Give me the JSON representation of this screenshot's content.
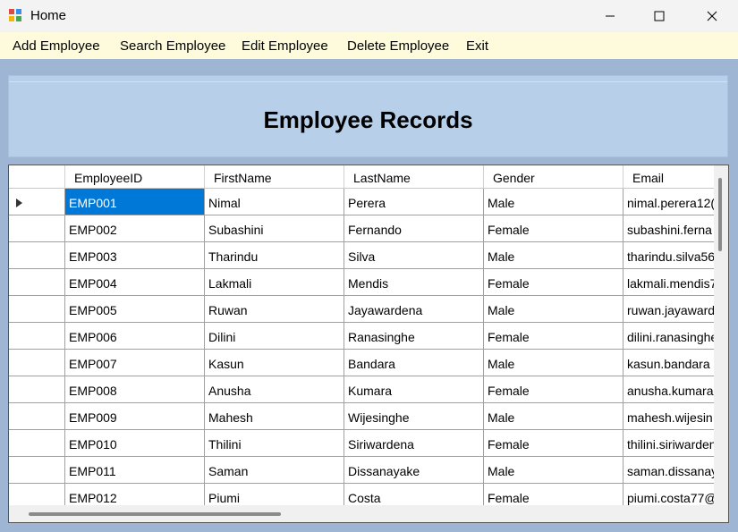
{
  "window": {
    "title": "Home"
  },
  "menu": [
    {
      "label": "Add Employee"
    },
    {
      "label": "Search Employee"
    },
    {
      "label": "Edit Employee"
    },
    {
      "label": "Delete Employee"
    },
    {
      "label": "Exit"
    }
  ],
  "header": {
    "title": "Employee Records"
  },
  "grid": {
    "columns": [
      "EmployeeID",
      "FirstName",
      "LastName",
      "Gender",
      "Email"
    ],
    "selected_row": 0,
    "rows": [
      [
        "EMP001",
        "Nimal",
        "Perera",
        "Male",
        "nimal.perera12("
      ],
      [
        "EMP002",
        "Subashini",
        "Fernando",
        "Female",
        "subashini.ferna"
      ],
      [
        "EMP003",
        "Tharindu",
        "Silva",
        "Male",
        "tharindu.silva56"
      ],
      [
        "EMP004",
        "Lakmali",
        "Mendis",
        "Female",
        "lakmali.mendis7"
      ],
      [
        "EMP005",
        "Ruwan",
        "Jayawardena",
        "Male",
        "ruwan.jayaward"
      ],
      [
        "EMP006",
        "Dilini",
        "Ranasinghe",
        "Female",
        "dilini.ranasinghe"
      ],
      [
        "EMP007",
        "Kasun",
        "Bandara",
        "Male",
        "kasun.bandara"
      ],
      [
        "EMP008",
        "Anusha",
        "Kumara",
        "Female",
        "anusha.kumara"
      ],
      [
        "EMP009",
        "Mahesh",
        "Wijesinghe",
        "Male",
        "mahesh.wijesin"
      ],
      [
        "EMP010",
        "Thilini",
        "Siriwardena",
        "Female",
        "thilini.siriwarden"
      ],
      [
        "EMP011",
        "Saman",
        "Dissanayake",
        "Male",
        "saman.dissanay"
      ],
      [
        "EMP012",
        "Piumi",
        "Costa",
        "Female",
        "piumi.costa77@"
      ]
    ]
  }
}
